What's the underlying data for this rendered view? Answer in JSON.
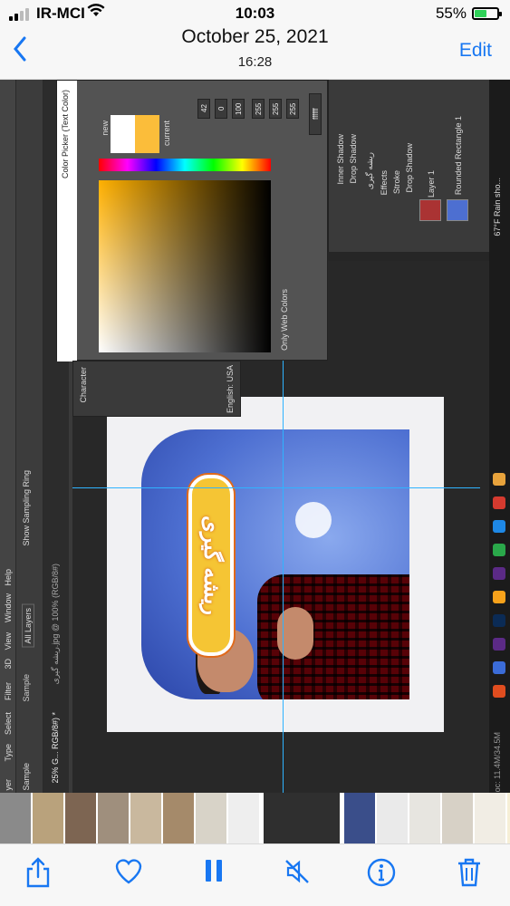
{
  "status": {
    "carrier": "IR-MCI",
    "time": "10:03",
    "battery": "55%"
  },
  "nav": {
    "back": "<",
    "date": "October 25, 2021",
    "time": "16:28",
    "edit": "Edit"
  },
  "photoshop": {
    "menu": [
      "yer",
      "Type",
      "Select",
      "Filter",
      "3D",
      "View",
      "Window",
      "Help"
    ],
    "tab_label": "25% G... RGB/8#) *",
    "doc_tab": "ریشه گیری.jpg @ 100% (RGB/8#)",
    "sample_label": "Sample",
    "sample_value": "All Layers",
    "show_ring": "Show Sampling Ring",
    "picker_title": "Color Picker (Text Color)",
    "new": "new",
    "current": "current",
    "only_web": "Only Web Colors",
    "hex": "ffffff",
    "h": "42",
    "s": "0",
    "b": "100",
    "r": "255",
    "g": "255",
    "bb": "255",
    "character": "Character",
    "language": "English: USA",
    "title_art": "ریشه گیری",
    "layers": {
      "inner_shadow": "Inner Shadow",
      "drop_shadow": "Drop Shadow",
      "text_layer": "ریشه گیری",
      "effects": "Effects",
      "stroke": "Stroke",
      "drop_shadow2": "Drop Shadow",
      "layer1": "Layer 1",
      "rounded": "Rounded Rectangle 1"
    },
    "weather": "67°F Rain sho...",
    "status_bar": "oc: 11.4M/34.5M"
  },
  "thumb_colors": [
    "#8a8a8a",
    "#b9a27c",
    "#7d6552",
    "#9f8f7d",
    "#c9b89e",
    "#a58a6a",
    "#d8d3c8",
    "#eeeeee",
    "#2f2f2f",
    "#3a4e8a",
    "#eaeaea",
    "#e7e5e0",
    "#d7d1c6",
    "#f1ede4",
    "#f6efd6",
    "#b3a98f",
    "#d9c27a",
    "#111111",
    "#000000"
  ]
}
